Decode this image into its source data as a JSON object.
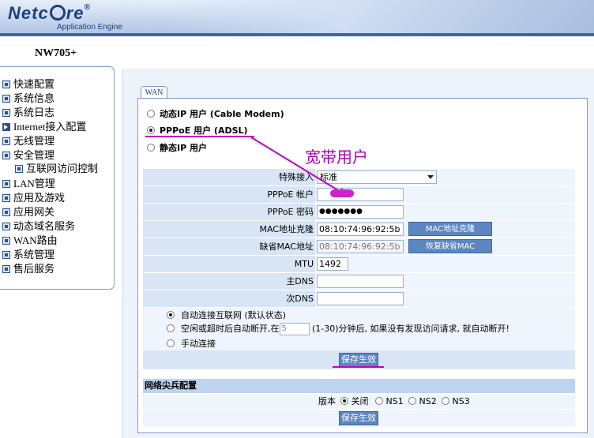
{
  "header": {
    "logo_left": "Netc",
    "logo_right": "re",
    "logo_mark": "®",
    "tagline": "Application Engine"
  },
  "device_model": "NW705+",
  "sidebar": {
    "items": [
      {
        "label": "快速配置",
        "icon": "square-bullet-icon"
      },
      {
        "label": "系统信息",
        "icon": "square-bullet-icon"
      },
      {
        "label": "系统日志",
        "icon": "square-bullet-icon"
      },
      {
        "label": "Internet接入配置",
        "icon": "arrow-bullet-icon",
        "active": true
      },
      {
        "label": "无线管理",
        "icon": "square-bullet-icon"
      },
      {
        "label": "安全管理",
        "icon": "square-bullet-icon"
      },
      {
        "label": "互联网访问控制",
        "icon": "square-bullet-icon",
        "sub": true
      },
      {
        "label": "LAN管理",
        "icon": "square-bullet-icon"
      },
      {
        "label": "应用及游戏",
        "icon": "square-bullet-icon"
      },
      {
        "label": "应用网关",
        "icon": "square-bullet-icon"
      },
      {
        "label": "动态域名服务",
        "icon": "square-bullet-icon"
      },
      {
        "label": "WAN路由",
        "icon": "square-bullet-icon"
      },
      {
        "label": "系统管理",
        "icon": "square-bullet-icon"
      },
      {
        "label": "售后服务",
        "icon": "square-bullet-icon"
      }
    ]
  },
  "main": {
    "tab_label": "WAN",
    "connection_types": [
      {
        "label": "动态IP 用户 (Cable Modem)",
        "selected": false
      },
      {
        "label": "PPPoE 用户 (ADSL)",
        "selected": true
      },
      {
        "label": "静态IP 用户",
        "selected": false
      }
    ],
    "form": {
      "special_access": {
        "label": "特殊接入",
        "value": "标准"
      },
      "account": {
        "label": "PPPoE 帐户",
        "value": ""
      },
      "password": {
        "label": "PPPoE 密码",
        "value": "●●●●●●●"
      },
      "mac_clone": {
        "label": "MAC地址克隆",
        "value": "08:10:74:96:92:5b",
        "button": "MAC地址克隆"
      },
      "mac_default": {
        "label": "缺省MAC地址",
        "value": "08:10:74:96:92:5b",
        "button": "恢复缺省MAC"
      },
      "mtu": {
        "label": "MTU",
        "value": "1492"
      },
      "primary_dns": {
        "label": "主DNS",
        "value": ""
      },
      "secondary_dns": {
        "label": "次DNS",
        "value": ""
      }
    },
    "connect_options": {
      "auto": {
        "label": "自动连接互联网 (默认状态)",
        "selected": true
      },
      "idle_prefix": "空闲或超时后自动断开,在",
      "idle_value": "5",
      "idle_suffix": "(1-30)分钟后, 如果没有发现访问请求, 就自动断开!",
      "manual": {
        "label": "手动连接",
        "selected": false
      }
    },
    "save_label": "保存生效",
    "ns_section": {
      "title": "网络尖兵配置",
      "version_label": "版本",
      "options": [
        {
          "label": "关闭",
          "selected": true
        },
        {
          "label": "NS1",
          "selected": false
        },
        {
          "label": "NS2",
          "selected": false
        },
        {
          "label": "NS3",
          "selected": false
        }
      ],
      "save_label": "保存生效"
    }
  },
  "annotation": {
    "text": "宽带用户",
    "color": "#b000b0"
  }
}
